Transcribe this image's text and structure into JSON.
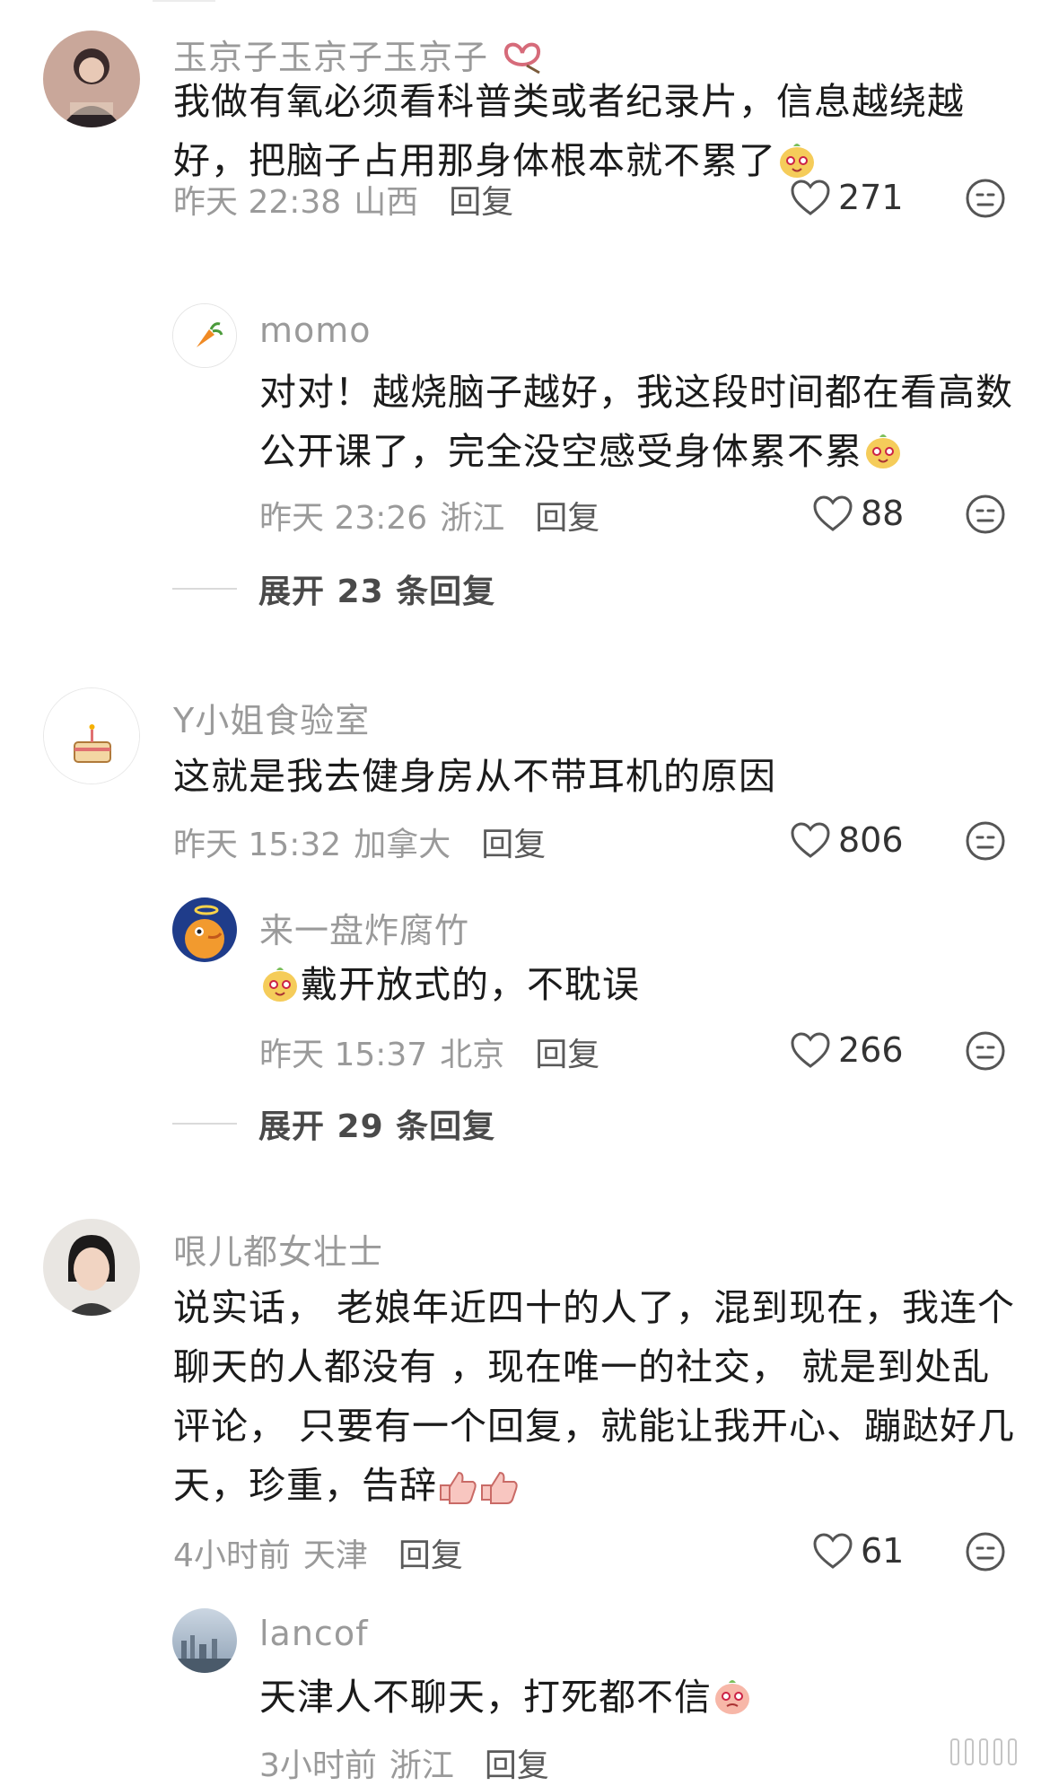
{
  "comments": [
    {
      "username": "玉京子玉京子玉京子",
      "text": "我做有氧必须看科普类或者纪录片，信息越绕越好，把脑子占用那身体根本就不累了",
      "time": "昨天 22:38",
      "location": "山西",
      "reply_label": "回复",
      "likes": "271",
      "replies": [
        {
          "username": "momo",
          "text": "对对！越烧脑子越好，我这段时间都在看高数公开课了，完全没空感受身体累不累",
          "time": "昨天 23:26",
          "location": "浙江",
          "reply_label": "回复",
          "likes": "88"
        }
      ],
      "expand_label": "展开 23 条回复"
    },
    {
      "username": "Y小姐食验室",
      "text": "这就是我去健身房从不带耳机的原因",
      "time": "昨天 15:32",
      "location": "加拿大",
      "reply_label": "回复",
      "likes": "806",
      "replies": [
        {
          "username": "来一盘炸腐竹",
          "text": "戴开放式的，不耽误",
          "time": "昨天 15:37",
          "location": "北京",
          "reply_label": "回复",
          "likes": "266"
        }
      ],
      "expand_label": "展开 29 条回复"
    },
    {
      "username": "哏儿都女壮士",
      "text": "说实话， 老娘年近四十的人了，混到现在，我连个聊天的人都没有 ，现在唯一的社交， 就是到处乱评论， 只要有一个回复，就能让我开心、蹦跶好几天，珍重，告辞",
      "time": "4小时前",
      "location": "天津",
      "reply_label": "回复",
      "likes": "61",
      "replies": [
        {
          "username": "lancof",
          "text": "天津人不聊天，打死都不信",
          "time": "3小时前",
          "location": "浙江",
          "reply_label": "回复"
        }
      ]
    }
  ],
  "icons": {
    "like": "heart-outline-icon",
    "dislike": "neutral-face-icon",
    "emoji": "smiling-mascot-emoji"
  },
  "colors": {
    "username": "#9a9a9a",
    "text": "#1b1b1b",
    "meta": "#9a9a9a",
    "reply": "#5a5a5a"
  }
}
